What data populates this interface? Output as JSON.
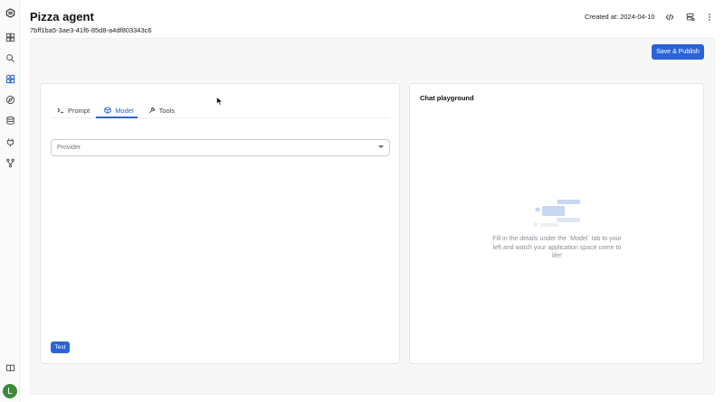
{
  "header": {
    "title": "Pizza agent",
    "agent_id": "7bff1ba5-3ae3-41f6-85d8-a4df803343c6",
    "created_at": "Created at: 2024-04-10"
  },
  "toolbar": {
    "save_publish_label": "Save & Publish"
  },
  "tabs": [
    {
      "label": "Prompt",
      "icon": "terminal-icon"
    },
    {
      "label": "Model",
      "icon": "cube-icon"
    },
    {
      "label": "Tools",
      "icon": "wrench-icon"
    }
  ],
  "model": {
    "provider_placeholder": "Provider",
    "test_label": "Test"
  },
  "chat": {
    "title": "Chat playground",
    "empty_message": "Fill in the details under the `Model` tab to your left and watch your application space come to life!"
  },
  "user": {
    "avatar_initial": "L"
  },
  "colors": {
    "accent": "#2a63d8",
    "avatar": "#3f8a3a"
  }
}
